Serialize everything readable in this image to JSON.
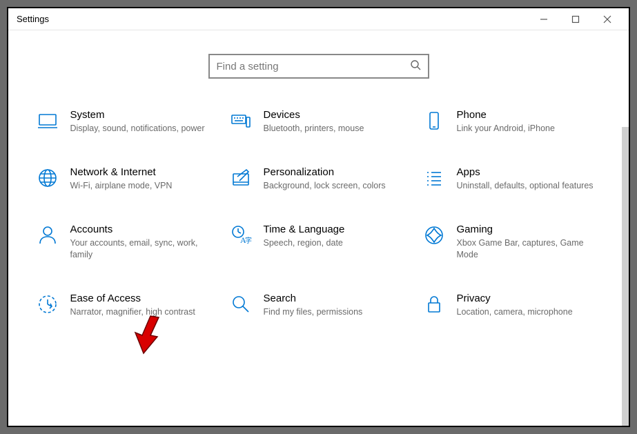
{
  "window": {
    "title": "Settings"
  },
  "search": {
    "placeholder": "Find a setting"
  },
  "categories": [
    {
      "id": "system",
      "icon": "monitor-icon",
      "title": "System",
      "desc": "Display, sound, notifications, power"
    },
    {
      "id": "devices",
      "icon": "keyboard-icon",
      "title": "Devices",
      "desc": "Bluetooth, printers, mouse"
    },
    {
      "id": "phone",
      "icon": "phone-icon",
      "title": "Phone",
      "desc": "Link your Android, iPhone"
    },
    {
      "id": "network",
      "icon": "globe-icon",
      "title": "Network & Internet",
      "desc": "Wi-Fi, airplane mode, VPN"
    },
    {
      "id": "personalization",
      "icon": "paint-icon",
      "title": "Personalization",
      "desc": "Background, lock screen, colors"
    },
    {
      "id": "apps",
      "icon": "list-icon",
      "title": "Apps",
      "desc": "Uninstall, defaults, optional features"
    },
    {
      "id": "accounts",
      "icon": "person-icon",
      "title": "Accounts",
      "desc": "Your accounts, email, sync, work, family"
    },
    {
      "id": "time-language",
      "icon": "time-language-icon",
      "title": "Time & Language",
      "desc": "Speech, region, date"
    },
    {
      "id": "gaming",
      "icon": "gaming-icon",
      "title": "Gaming",
      "desc": "Xbox Game Bar, captures, Game Mode"
    },
    {
      "id": "ease-of-access",
      "icon": "ease-of-access-icon",
      "title": "Ease of Access",
      "desc": "Narrator, magnifier, high contrast"
    },
    {
      "id": "search",
      "icon": "search-icon",
      "title": "Search",
      "desc": "Find my files, permissions"
    },
    {
      "id": "privacy",
      "icon": "lock-icon",
      "title": "Privacy",
      "desc": "Location, camera, microphone"
    }
  ]
}
